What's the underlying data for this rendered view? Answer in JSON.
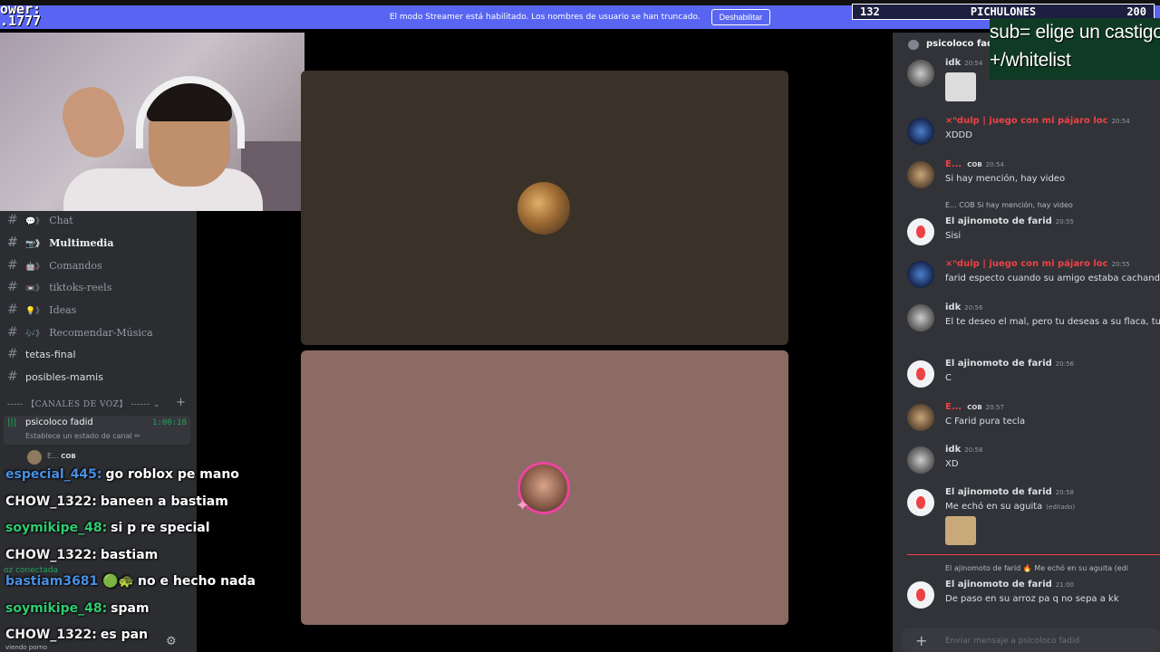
{
  "overlay": {
    "power_text": "ower:\n.1777",
    "counter_left": "132",
    "counter_title": "PICHULONES",
    "counter_right": "200",
    "sub_line1": "sub= elige un castigo",
    "sub_line2": "+/whitelist"
  },
  "banner": {
    "text": "El modo Streamer está habilitado. Los nombres de usuario se han truncado.",
    "button_label": "Deshabilitar"
  },
  "sidebar": {
    "channels": [
      {
        "emoji": "💬》",
        "label": "Chat",
        "active": false
      },
      {
        "emoji": "📷》",
        "label": "Multimedia",
        "active": true
      },
      {
        "emoji": "🤖》",
        "label": "Comandos",
        "active": false
      },
      {
        "emoji": "📼》",
        "label": "tiktoks-reels",
        "active": false
      },
      {
        "emoji": "💡》",
        "label": "Ideas",
        "active": false
      },
      {
        "emoji": "🎶》",
        "label": "Recomendar-Música",
        "active": false
      },
      {
        "emoji": "",
        "label": "tetas-final",
        "active": false
      },
      {
        "emoji": "",
        "label": "posibles-mamis",
        "active": false
      }
    ],
    "voice_header": "----- 【CANALES DE VOZ】 ------ ⌄",
    "voice_channel": {
      "name": "psicoloco fadid",
      "time": "1:00:18",
      "status": "Establece un estado de canal ✏",
      "member": "E...",
      "member_badge": "COB"
    },
    "vc_connected": "oz conectada",
    "watching": "viendo porno"
  },
  "stream_chat": [
    {
      "user": "especial_445:",
      "color": "#4a90e2",
      "msg": "go roblox pe mano"
    },
    {
      "user": "CHOW_1322:",
      "color": "#f0f0f0",
      "msg": "baneen a bastiam"
    },
    {
      "user": "soymikipe_48:",
      "color": "#2ecc71",
      "msg": "si p re special"
    },
    {
      "user": "CHOW_1322:",
      "color": "#f0f0f0",
      "msg": "bastiam"
    },
    {
      "user": "bastiam3681 🟢🐢",
      "color": "#4a90e2",
      "msg": "no e hecho nada"
    },
    {
      "user": "soymikipe_48:",
      "color": "#2ecc71",
      "msg": "spam"
    },
    {
      "user": "CHOW_1322:",
      "color": "#f0f0f0",
      "msg": "es pan"
    }
  ],
  "right_panel": {
    "channel_name": "psicoloco fadid",
    "messages": [
      {
        "name": "idk",
        "time": "20:54",
        "text": "",
        "style": "white",
        "avatar": "gray"
      },
      {
        "name": "×ⁿdulp | juego con mi pájaro loc",
        "time": "20:54",
        "text": "XDDD",
        "style": "red",
        "avatar": "blue"
      },
      {
        "name": "E...",
        "badge": "COB",
        "time": "20:54",
        "text": "Si hay mención, hay video",
        "style": "red",
        "avatar": "tan"
      },
      {
        "name": "El ajinomoto de farid",
        "time": "20:55",
        "text": "Sisi",
        "style": "white",
        "avatar": "logo",
        "reply": "E... COB Si hay mención, hay video"
      },
      {
        "name": "×ⁿdulp | juego con mi pájaro loc",
        "time": "20:55",
        "text": "farid especto cuando su amigo estaba cachando",
        "style": "red",
        "avatar": "blue"
      },
      {
        "name": "idk",
        "time": "20:56",
        "text": "El te deseo el mal, pero tu deseas a su flaca, tu g",
        "style": "white",
        "avatar": "gray"
      },
      {
        "name": "El ajinomoto de farid",
        "time": "20:56",
        "text": "C",
        "style": "white",
        "avatar": "logo"
      },
      {
        "name": "E...",
        "badge": "COB",
        "time": "20:57",
        "text": "C Farid pura tecla",
        "style": "red",
        "avatar": "tan"
      },
      {
        "name": "idk",
        "time": "20:58",
        "text": "XD",
        "style": "white",
        "avatar": "gray"
      },
      {
        "name": "El ajinomoto de farid",
        "time": "20:58",
        "text": "Me echó en su aguita",
        "edited": "(editado)",
        "style": "white",
        "avatar": "logo"
      },
      {
        "name": "El ajinomoto de farid",
        "time": "21:00",
        "text": "De paso en su arroz pa q no sepa a kk",
        "style": "white",
        "avatar": "logo",
        "reply": "El ajinomoto de farid 🔥 Me echó en su aguita (edi"
      }
    ],
    "input_placeholder": "Enviar mensaje a psicoloco fadid"
  }
}
